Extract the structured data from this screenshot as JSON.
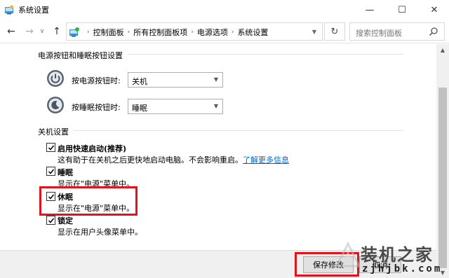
{
  "window": {
    "title": "系统设置",
    "minimize": "—",
    "maximize": "☐",
    "close": "✕"
  },
  "nav": {
    "back": "←",
    "forward": "→",
    "history": "∨",
    "up": "↑",
    "breadcrumbs": [
      "控制面板",
      "所有控制面板项",
      "电源选项",
      "系统设置"
    ],
    "separator": "›",
    "refresh": "↻",
    "search_placeholder": "搜索控制面板"
  },
  "power_section": {
    "title": "电源按钮和睡眠按钮设置",
    "power_button": {
      "label": "按电源按钮时:",
      "value": "关机"
    },
    "sleep_button": {
      "label": "按睡眠按钮时:",
      "value": "睡眠"
    }
  },
  "shutdown_section": {
    "title": "关机设置",
    "items": [
      {
        "title": "启用快速启动(推荐)",
        "desc": "这有助于在关机之后更快地启动电脑。不会影响重启。",
        "link": "了解更多信息",
        "checked": true
      },
      {
        "title": "睡眠",
        "desc": "显示在\"电源\"菜单中。",
        "checked": true
      },
      {
        "title": "休眠",
        "desc": "显示在\"电源\"菜单中。",
        "checked": true
      },
      {
        "title": "锁定",
        "desc": "显示在用户头像菜单中。",
        "checked": true
      }
    ]
  },
  "footer": {
    "save": "保存修改",
    "cancel": "取消"
  },
  "watermark": {
    "line1": "装机之家",
    "line2": "zjhjbk.com"
  },
  "colors": {
    "highlight": "#e0141e",
    "link": "#0066cc"
  }
}
